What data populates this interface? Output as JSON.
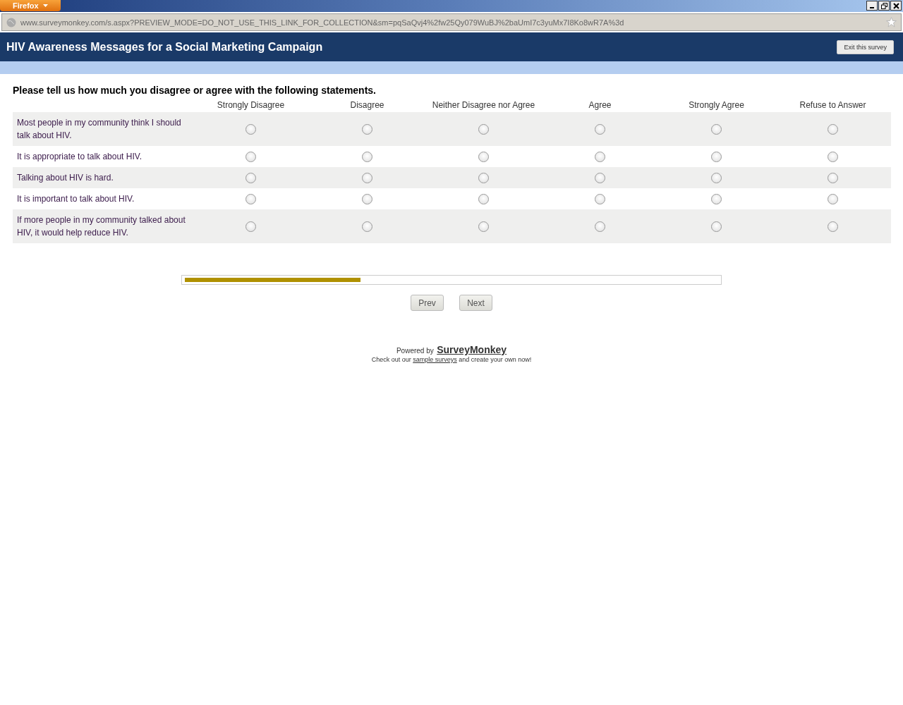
{
  "browser": {
    "menu_button": "Firefox",
    "url": "www.surveymonkey.com/s.aspx?PREVIEW_MODE=DO_NOT_USE_THIS_LINK_FOR_COLLECTION&sm=pqSaQvj4%2fw25Qy079WuBJ%2baUmI7c3yuMx7I8Ko8wR7A%3d"
  },
  "header": {
    "title": "HIV Awareness Messages for a Social Marketing Campaign",
    "exit_button": "Exit this survey"
  },
  "question": {
    "prompt": "Please tell us how much you disagree or agree with the following statements.",
    "columns": [
      "Strongly Disagree",
      "Disagree",
      "Neither Disagree nor Agree",
      "Agree",
      "Strongly Agree",
      "Refuse to Answer"
    ],
    "rows": [
      {
        "statement": "Most people in my community think I should talk about HIV.",
        "choices": [
          {
            "selected": false
          },
          {
            "selected": false
          },
          {
            "selected": false
          },
          {
            "selected": false
          },
          {
            "selected": false
          },
          {
            "selected": false
          }
        ]
      },
      {
        "statement": "It is appropriate to talk about HIV.",
        "choices": [
          {
            "selected": false
          },
          {
            "selected": false
          },
          {
            "selected": false
          },
          {
            "selected": false
          },
          {
            "selected": false
          },
          {
            "selected": false
          }
        ]
      },
      {
        "statement": "Talking about HIV is hard.",
        "choices": [
          {
            "selected": false
          },
          {
            "selected": false
          },
          {
            "selected": false
          },
          {
            "selected": false
          },
          {
            "selected": false
          },
          {
            "selected": false
          }
        ]
      },
      {
        "statement": "It is important to talk about HIV.",
        "choices": [
          {
            "selected": false
          },
          {
            "selected": false
          },
          {
            "selected": false
          },
          {
            "selected": false
          },
          {
            "selected": false
          },
          {
            "selected": false
          }
        ]
      },
      {
        "statement": "If more people in my community talked about HIV, it would help reduce HIV.",
        "choices": [
          {
            "selected": false
          },
          {
            "selected": false
          },
          {
            "selected": false
          },
          {
            "selected": false
          },
          {
            "selected": false
          },
          {
            "selected": false
          }
        ]
      }
    ]
  },
  "progress": {
    "level": 0.33
  },
  "nav": {
    "prev": "Prev",
    "next": "Next"
  },
  "footer": {
    "powered_by": "Powered by",
    "brand_link": "SurveyMonkey",
    "line_before": "Check out our",
    "link": "sample surveys",
    "line_after": "and create your own now!"
  }
}
